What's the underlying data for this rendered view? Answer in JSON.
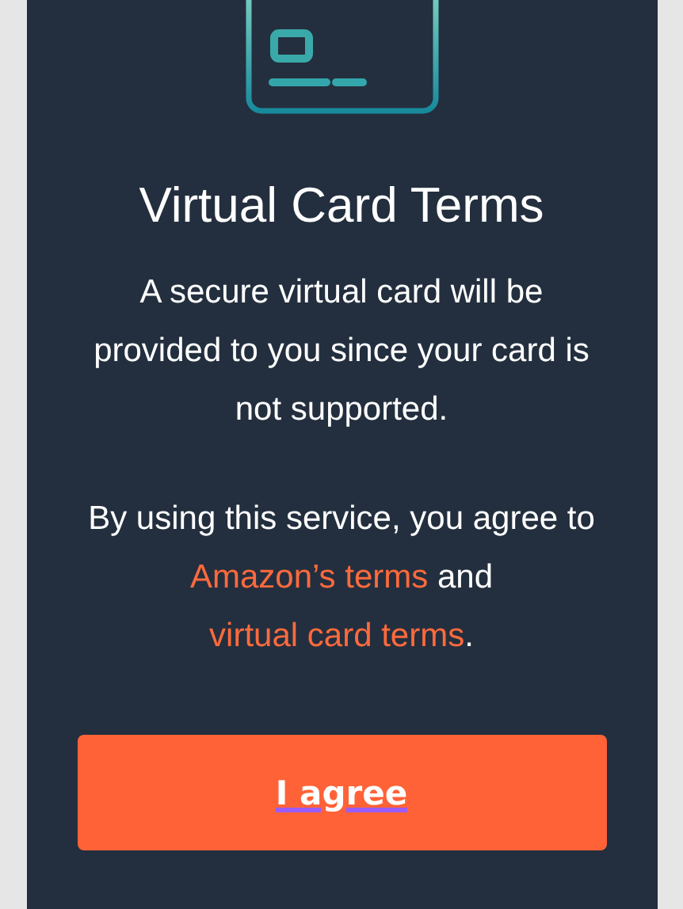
{
  "title": "Virtual Card Terms",
  "message": "A secure virtual card will be provided to you since your card is not supported.",
  "terms": {
    "before": "By using this service, you agree to ",
    "link_1": "Amazon’s terms",
    "middle": " and ",
    "link_2": "virtual card terms",
    "after": "."
  },
  "button": "I agree"
}
